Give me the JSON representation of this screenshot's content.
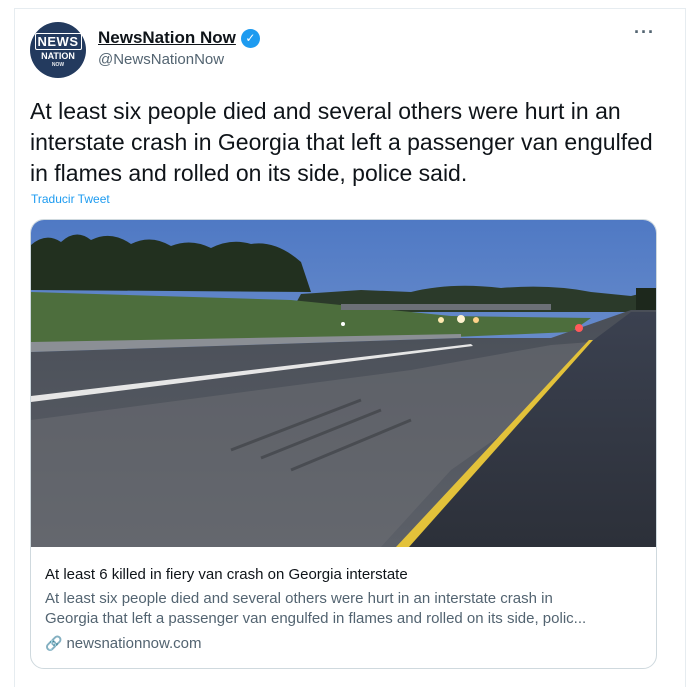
{
  "author": {
    "display_name": "NewsNation Now",
    "handle": "@NewsNationNow",
    "avatar_text": [
      "NEWS",
      "NATION",
      "NOW"
    ],
    "verified_icon": "verified-badge-icon"
  },
  "more_label": "···",
  "tweet": {
    "text": "At least six people died and several others were hurt in an interstate crash in Georgia that left a passenger van engulfed in flames and rolled on its side, police said.",
    "translate_label": "Traducir Tweet"
  },
  "card": {
    "title": "At least 6 killed in fiery van crash on Georgia interstate",
    "description_line1": "At least six people died and several others were hurt in an interstate crash in",
    "description_line2": "Georgia that left a passenger van engulfed in flames and rolled on its side, polic...",
    "domain": "newsnationnow.com",
    "link_icon": "link-icon"
  },
  "colors": {
    "accent": "#1d9bf0",
    "avatar_bg": "#233a5e",
    "road_line_yellow": "#e3c23a"
  }
}
